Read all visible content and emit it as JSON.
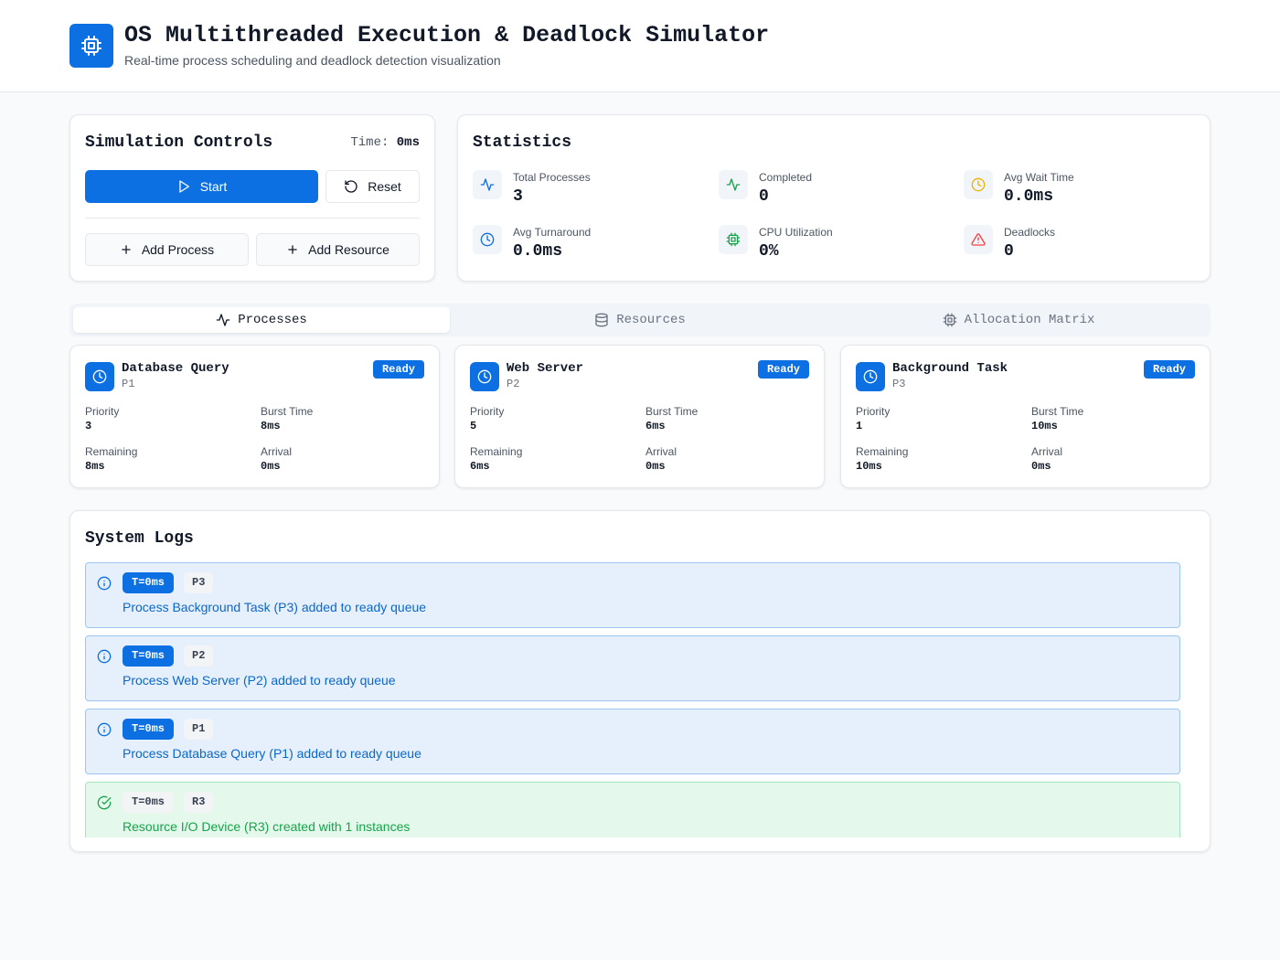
{
  "header": {
    "title": "OS Multithreaded Execution & Deadlock Simulator",
    "subtitle": "Real-time process scheduling and deadlock detection visualization",
    "logo_icon": "cpu-icon"
  },
  "controls": {
    "title": "Simulation Controls",
    "time_label": "Time:",
    "time_value": "0ms",
    "start_label": "Start",
    "reset_label": "Reset",
    "add_process_label": "Add Process",
    "add_resource_label": "Add Resource"
  },
  "statistics": {
    "title": "Statistics",
    "items": [
      {
        "label": "Total Processes",
        "value": "3",
        "icon": "activity-icon"
      },
      {
        "label": "Completed",
        "value": "0",
        "icon": "activity-icon"
      },
      {
        "label": "Avg Wait Time",
        "value": "0.0ms",
        "icon": "clock-icon"
      },
      {
        "label": "Avg Turnaround",
        "value": "0.0ms",
        "icon": "clock-icon"
      },
      {
        "label": "CPU Utilization",
        "value": "0%",
        "icon": "cpu-icon"
      },
      {
        "label": "Deadlocks",
        "value": "0",
        "icon": "alert-triangle-icon"
      }
    ]
  },
  "tabs": [
    {
      "label": "Processes",
      "icon": "activity-icon",
      "active": true
    },
    {
      "label": "Resources",
      "icon": "database-icon",
      "active": false
    },
    {
      "label": "Allocation Matrix",
      "icon": "cpu-icon",
      "active": false
    }
  ],
  "field_labels": {
    "priority": "Priority",
    "burst": "Burst Time",
    "remaining": "Remaining",
    "arrival": "Arrival"
  },
  "processes": [
    {
      "name": "Database Query",
      "id": "P1",
      "status": "Ready",
      "priority": "3",
      "burst": "8ms",
      "remaining": "8ms",
      "arrival": "0ms"
    },
    {
      "name": "Web Server",
      "id": "P2",
      "status": "Ready",
      "priority": "5",
      "burst": "6ms",
      "remaining": "6ms",
      "arrival": "0ms"
    },
    {
      "name": "Background Task",
      "id": "P3",
      "status": "Ready",
      "priority": "1",
      "burst": "10ms",
      "remaining": "10ms",
      "arrival": "0ms"
    }
  ],
  "logs": {
    "title": "System Logs",
    "entries": [
      {
        "type": "info",
        "time": "T=0ms",
        "entity": "P3",
        "message": "Process Background Task (P3) added to ready queue"
      },
      {
        "type": "info",
        "time": "T=0ms",
        "entity": "P2",
        "message": "Process Web Server (P2) added to ready queue"
      },
      {
        "type": "info",
        "time": "T=0ms",
        "entity": "P1",
        "message": "Process Database Query (P1) added to ready queue"
      },
      {
        "type": "success",
        "time": "T=0ms",
        "entity": "R3",
        "message": "Resource I/O Device (R3) created with 1 instances"
      }
    ]
  },
  "colors": {
    "primary": "#0c6fe2",
    "info_bg": "#e5f0fc",
    "success_bg": "#e5f8ec",
    "success": "#16a34a",
    "warning": "#eab308",
    "danger": "#ef4444"
  }
}
